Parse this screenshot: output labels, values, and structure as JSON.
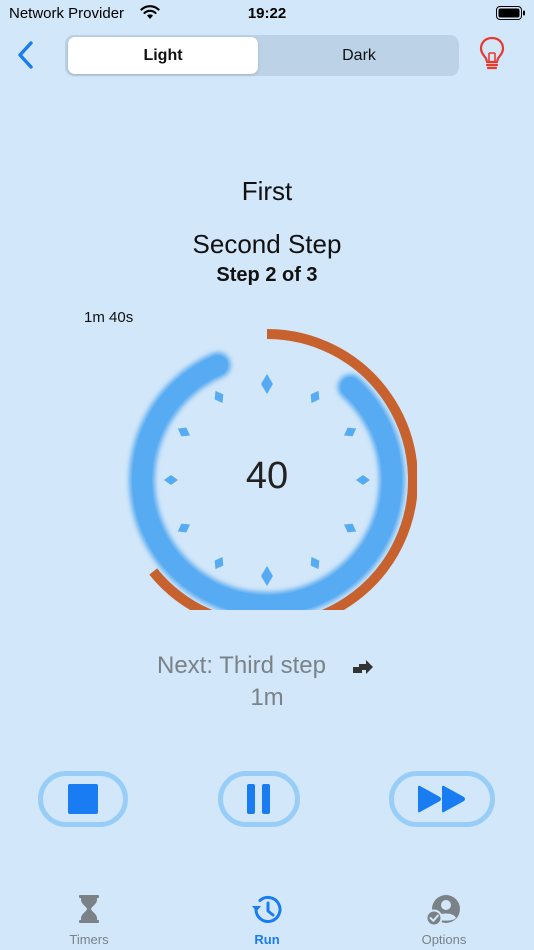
{
  "status_bar": {
    "carrier": "Network Provider",
    "time": "19:22"
  },
  "nav": {
    "back_icon": "chevron-left-icon",
    "theme_options": [
      "Light",
      "Dark"
    ],
    "selected_theme": "Light",
    "bulb_icon": "lightbulb-icon"
  },
  "timer": {
    "name": "First",
    "step_name": "Second Step",
    "step_progress": "Step 2 of 3",
    "total_remaining": "1m 40s",
    "countdown": "40",
    "next_label": "Next: Third step",
    "next_duration": "1m",
    "step_fraction_remaining": 0.83,
    "total_fraction_remaining": 0.67
  },
  "controls": {
    "stop_icon": "stop-icon",
    "pause_icon": "pause-icon",
    "skip_icon": "fast-forward-icon"
  },
  "tabs": [
    {
      "label": "Timers",
      "icon": "hourglass-icon",
      "active": false
    },
    {
      "label": "Run",
      "icon": "clock-history-icon",
      "active": true
    },
    {
      "label": "Options",
      "icon": "person-check-icon",
      "active": false
    }
  ],
  "colors": {
    "background": "#d2e7f9",
    "accent_blue": "#1a7cf2",
    "dial_blue": "#56abf2",
    "total_orange": "#c7622f",
    "bulb_red": "#e8392f",
    "inactive_gray": "#7a8288"
  }
}
